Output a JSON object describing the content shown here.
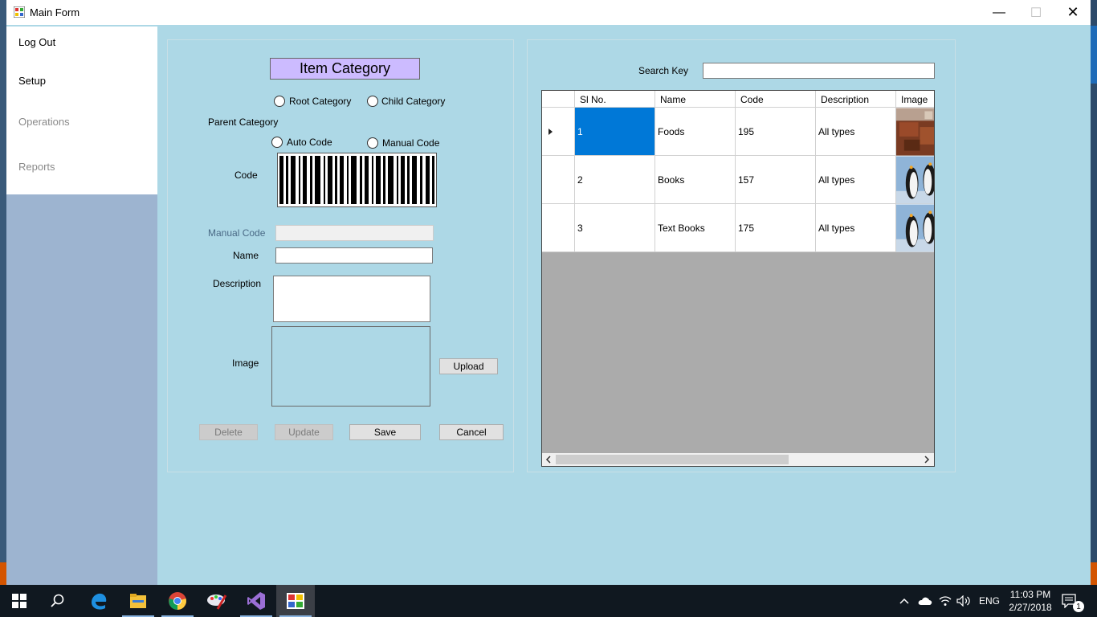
{
  "window": {
    "title": "Main Form"
  },
  "menu": {
    "items": [
      {
        "label": "Log Out",
        "enabled": true
      },
      {
        "label": "Setup",
        "enabled": true
      },
      {
        "label": "Operations",
        "enabled": false
      },
      {
        "label": "Reports",
        "enabled": false
      }
    ]
  },
  "form": {
    "header": "Item Category",
    "radio_root": "Root Category",
    "radio_child": "Child Category",
    "parent_category_label": "Parent Category",
    "radio_auto_code": "Auto Code",
    "radio_manual_code": "Manual Code",
    "code_label": "Code",
    "manual_code_label": "Manual Code",
    "manual_code_value": "",
    "name_label": "Name",
    "name_value": "",
    "description_label": "Description",
    "description_value": "",
    "image_label": "Image",
    "upload_button": "Upload",
    "delete_button": "Delete",
    "update_button": "Update",
    "save_button": "Save",
    "cancel_button": "Cancel"
  },
  "search": {
    "label": "Search Key",
    "value": ""
  },
  "grid": {
    "columns": [
      "Sl No.",
      "Name",
      "Code",
      "Description",
      "Image"
    ],
    "rows": [
      {
        "sl": "1",
        "name": "Foods",
        "code": "195",
        "description": "All types",
        "image": "furniture-photo"
      },
      {
        "sl": "2",
        "name": "Books",
        "code": "157",
        "description": "All types",
        "image": "penguins-photo"
      },
      {
        "sl": "3",
        "name": "Text Books",
        "code": "175",
        "description": "All types",
        "image": "penguins-photo"
      }
    ],
    "selected_row": 1
  },
  "taskbar": {
    "apps": [
      "start-icon",
      "search-icon",
      "edge-icon",
      "file-explorer-icon",
      "chrome-icon",
      "paint-icon",
      "visual-studio-icon",
      "main-form-app-icon"
    ],
    "language": "ENG",
    "time": "11:03 PM",
    "date": "2/27/2018",
    "notification_count": "1"
  },
  "colors": {
    "form_background": "#add8e6",
    "header_background": "#ccbbff",
    "selection": "#0078d7",
    "grid_background": "#ababab"
  }
}
